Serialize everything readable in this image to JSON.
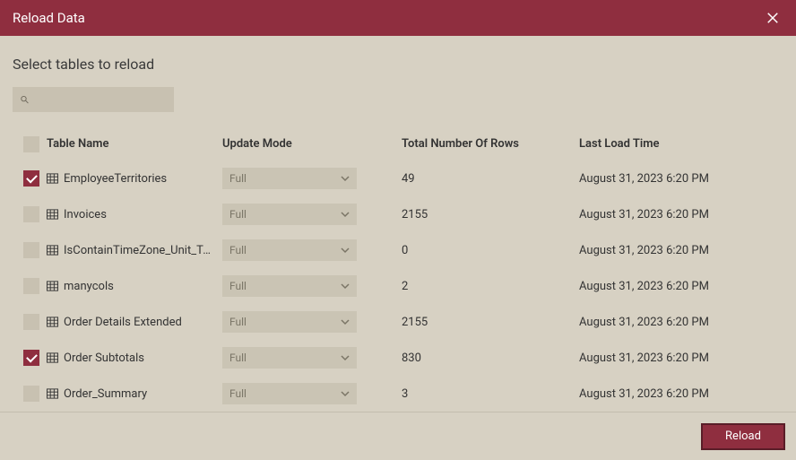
{
  "dialog": {
    "title": "Reload Data",
    "subtitle": "Select tables to reload",
    "reload_button": "Reload"
  },
  "search": {
    "placeholder": ""
  },
  "columns": {
    "name": "Table Name",
    "mode": "Update Mode",
    "rows": "Total Number Of Rows",
    "time": "Last Load Time"
  },
  "tables": [
    {
      "name": "EmployeeTerritories",
      "mode": "Full",
      "rows": "49",
      "time": "August 31, 2023 6:20 PM",
      "checked": true
    },
    {
      "name": "Invoices",
      "mode": "Full",
      "rows": "2155",
      "time": "August 31, 2023 6:20 PM",
      "checked": false
    },
    {
      "name": "IsContainTimeZone_Unit_Test",
      "mode": "Full",
      "rows": "0",
      "time": "August 31, 2023 6:20 PM",
      "checked": false
    },
    {
      "name": "manycols",
      "mode": "Full",
      "rows": "2",
      "time": "August 31, 2023 6:20 PM",
      "checked": false
    },
    {
      "name": "Order Details Extended",
      "mode": "Full",
      "rows": "2155",
      "time": "August 31, 2023 6:20 PM",
      "checked": false
    },
    {
      "name": "Order Subtotals",
      "mode": "Full",
      "rows": "830",
      "time": "August 31, 2023 6:20 PM",
      "checked": true
    },
    {
      "name": "Order_Summary",
      "mode": "Full",
      "rows": "3",
      "time": "August 31, 2023 6:20 PM",
      "checked": false
    }
  ]
}
